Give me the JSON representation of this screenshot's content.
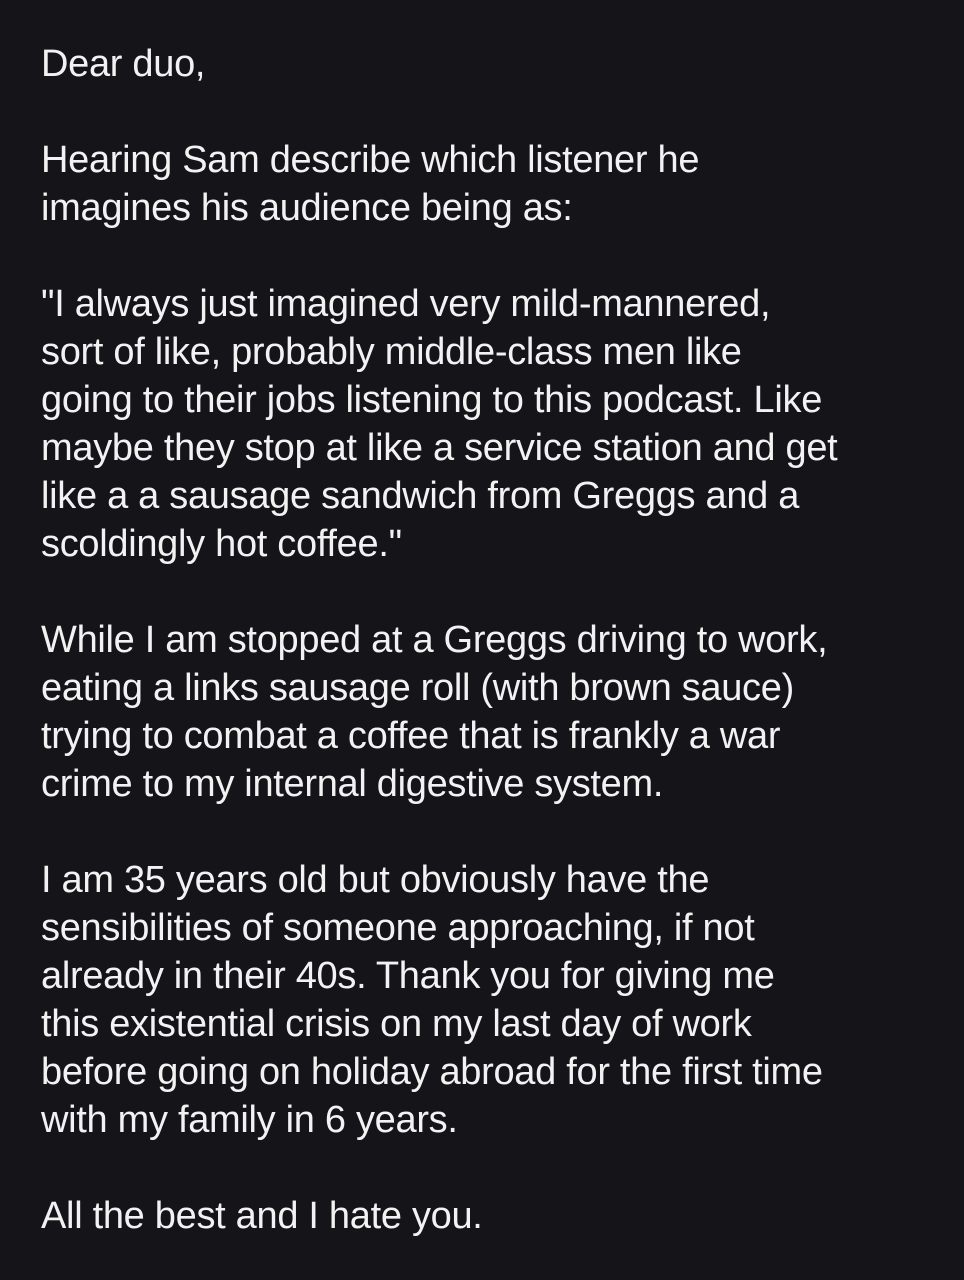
{
  "letter": {
    "greeting": "Dear duo,",
    "paragraphs": [
      {
        "lines": [
          "Hearing Sam describe which listener he",
          "imagines his audience being as:"
        ]
      },
      {
        "lines": [
          "\"I always just imagined very mild-mannered,",
          "sort of like, probably middle-class men like",
          "going to their jobs listening to this podcast. Like",
          "maybe they stop at like a service station and get",
          "like a a sausage sandwich from Greggs and a",
          "scoldingly hot coffee.\""
        ]
      },
      {
        "lines": [
          "While I am stopped at a Greggs driving to work,",
          "eating a links sausage roll (with brown sauce)",
          "trying to combat a coffee that is frankly a war",
          "crime to my internal digestive system."
        ]
      },
      {
        "lines": [
          "I am 35 years old but obviously have the",
          "sensibilities of someone approaching, if not",
          "already in their 40s. Thank you for giving me",
          "this existential crisis on my last day of work",
          "before going on holiday abroad for the first time",
          "with my family in 6 years."
        ]
      }
    ],
    "signoff": "All the best and I hate you."
  },
  "colors": {
    "background": "#141419",
    "text": "#f2f2f2"
  }
}
